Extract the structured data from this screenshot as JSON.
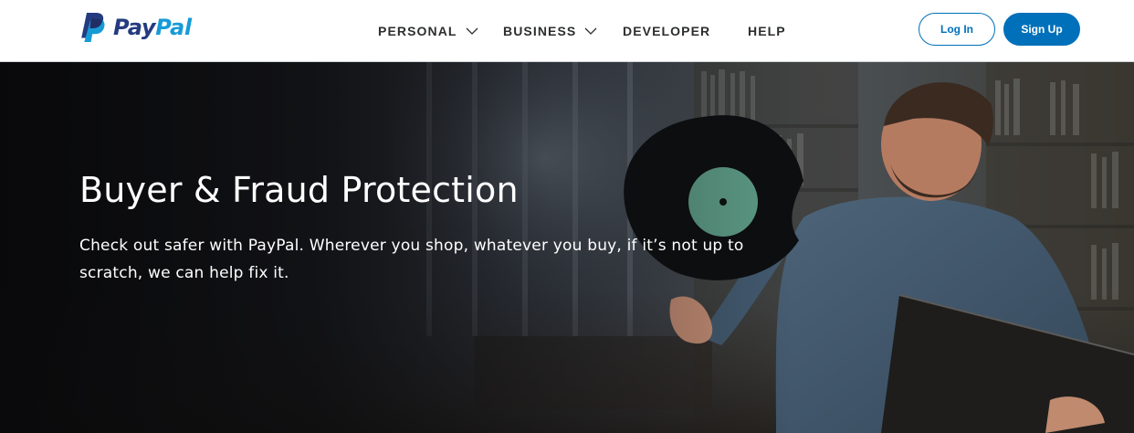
{
  "brand": {
    "name_pay": "Pay",
    "name_pal": "Pal",
    "colors": {
      "dark_blue": "#253b80",
      "light_blue": "#179bd7",
      "accent": "#0070ba"
    }
  },
  "nav": {
    "items": [
      {
        "label": "PERSONAL",
        "has_dropdown": true
      },
      {
        "label": "BUSINESS",
        "has_dropdown": true
      },
      {
        "label": "DEVELOPER",
        "has_dropdown": false
      },
      {
        "label": "HELP",
        "has_dropdown": false
      }
    ]
  },
  "auth": {
    "login_label": "Log In",
    "signup_label": "Sign Up"
  },
  "hero": {
    "title": "Buyer & Fraud Protection",
    "subtitle": "Check out safer with PayPal. Wherever you shop, whatever you buy, if it’s not up to scratch, we can help fix it."
  }
}
